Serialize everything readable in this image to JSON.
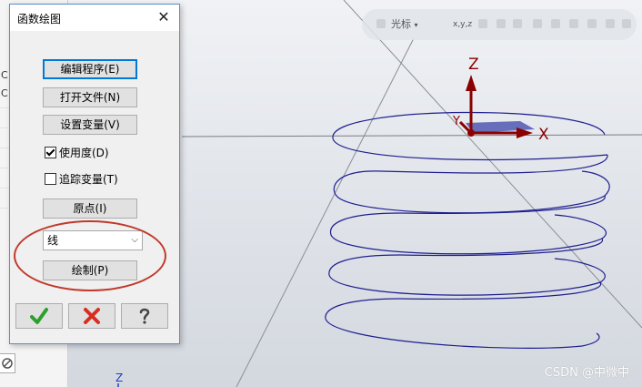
{
  "host": {
    "left_letters": [
      "C",
      "C"
    ],
    "axis_letter_bottom": "Z"
  },
  "toolbar": {
    "cursor_label": "光标",
    "cursor_arrow": "▾",
    "xyz_label": "x,y,z"
  },
  "axes": {
    "z": "Z",
    "x": "X",
    "y": "Y"
  },
  "dialog": {
    "title": "函数绘图",
    "close_glyph": "✕",
    "buttons": {
      "edit_program": "编辑程序(E)",
      "open_file": "打开文件(N)",
      "set_variables": "设置变量(V)",
      "origin": "原点(I)",
      "draw": "绘制(P)"
    },
    "checkboxes": {
      "use_degrees": {
        "label": "使用度(D)",
        "checked": true
      },
      "trace_variables": {
        "label": "追踪变量(T)",
        "checked": false
      }
    },
    "select": {
      "value": "线"
    },
    "footer": {
      "ok_icon": "checkmark-icon",
      "cancel_icon": "cross-icon",
      "help_icon": "question-icon"
    }
  },
  "watermark": "CSDN @中微中",
  "colors": {
    "helix": "#1f1f8f",
    "axis": "#8b0000",
    "highlight_oval": "#c0392b",
    "ok_green": "#2ca02c",
    "cancel_red": "#d62f1f"
  }
}
